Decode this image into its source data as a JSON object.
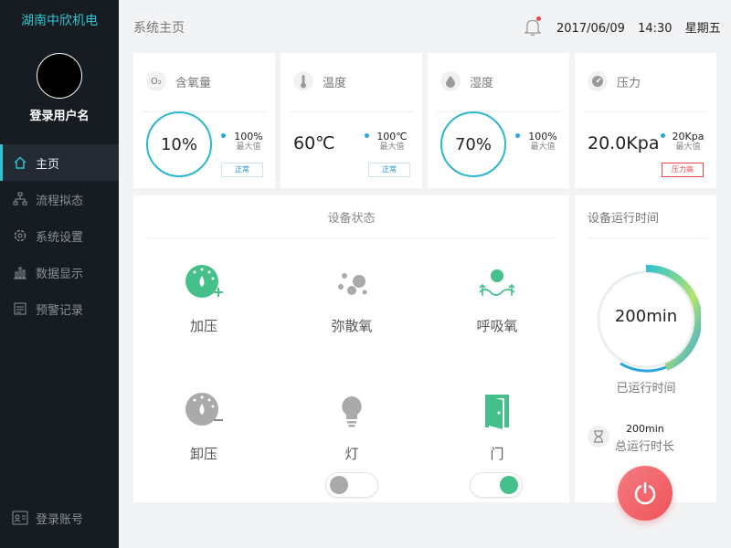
{
  "app": {
    "brand": "湖南中欣机电",
    "username": "登录用户名"
  },
  "sidebar": {
    "items": [
      {
        "label": "主页",
        "icon": "home-icon",
        "active": true
      },
      {
        "label": "流程拟态",
        "icon": "flow-icon",
        "active": false
      },
      {
        "label": "系统设置",
        "icon": "gear-icon",
        "active": false
      },
      {
        "label": "数据显示",
        "icon": "bar-chart-icon",
        "active": false
      },
      {
        "label": "预警记录",
        "icon": "record-icon",
        "active": false
      }
    ],
    "logout": "登录账号"
  },
  "header": {
    "title": "系统主页",
    "date": "2017/06/09",
    "time": "14:30",
    "weekday": "星期五"
  },
  "cards": [
    {
      "title": "含氧量",
      "icon_label": "O₂",
      "value": "10%",
      "max_value": "100%",
      "max_label": "最大值",
      "tag": "正常",
      "percent": 10
    },
    {
      "title": "温度",
      "value": "60℃",
      "max_value": "100℃",
      "max_label": "最大值",
      "tag": "正常"
    },
    {
      "title": "湿度",
      "value": "70%",
      "max_value": "100%",
      "max_label": "最大值",
      "percent": 70
    },
    {
      "title": "压力",
      "value": "20.0Kpa",
      "max_value": "20Kpa",
      "max_label": "最大值",
      "tag": "压力高"
    }
  ],
  "status": {
    "title": "设备状态",
    "devices": [
      {
        "label": "加压",
        "icon": "pressurize-icon"
      },
      {
        "label": "弥散氧",
        "icon": "diffuse-oxygen-icon"
      },
      {
        "label": "呼吸氧",
        "icon": "breathing-oxygen-icon"
      },
      {
        "label": "卸压",
        "icon": "depressurize-icon"
      },
      {
        "label": "灯",
        "icon": "light-bulb-icon",
        "toggle": false
      },
      {
        "label": "门",
        "icon": "door-icon",
        "toggle": true
      }
    ]
  },
  "runtime": {
    "title": "设备运行时间",
    "value": "200min",
    "label": "已运行时间",
    "total_value": "200min",
    "total_label": "总运行时长"
  },
  "colors": {
    "accent": "#2fc2cf",
    "green": "#46c08a",
    "alarm": "#e8484a",
    "sidebar": "#171c22"
  }
}
